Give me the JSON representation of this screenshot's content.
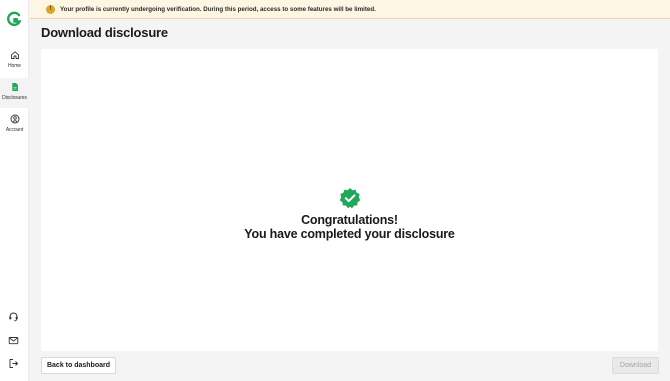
{
  "sidebar": {
    "logo": "brand-logo",
    "items": [
      {
        "label": "Home",
        "icon": "home-icon"
      },
      {
        "label": "Disclosures",
        "icon": "document-icon",
        "active": true
      },
      {
        "label": "Account",
        "icon": "user-circle-icon"
      }
    ],
    "bottom_icons": [
      "headset-icon",
      "mail-icon",
      "logout-icon"
    ]
  },
  "banner": {
    "text": "Your profile is currently undergoing verification. During this period, access to some features will be limited.",
    "icon": "warning-icon"
  },
  "page": {
    "title": "Download disclosure"
  },
  "success": {
    "icon": "verified-badge-icon",
    "line1": "Congratulations!",
    "line2": "You have completed your disclosure"
  },
  "footer": {
    "back_label": "Back to dashboard",
    "download_label": "Download"
  },
  "colors": {
    "accent": "#1fa85a",
    "banner_bg": "#fdf6e3",
    "warning": "#d9a52b"
  }
}
